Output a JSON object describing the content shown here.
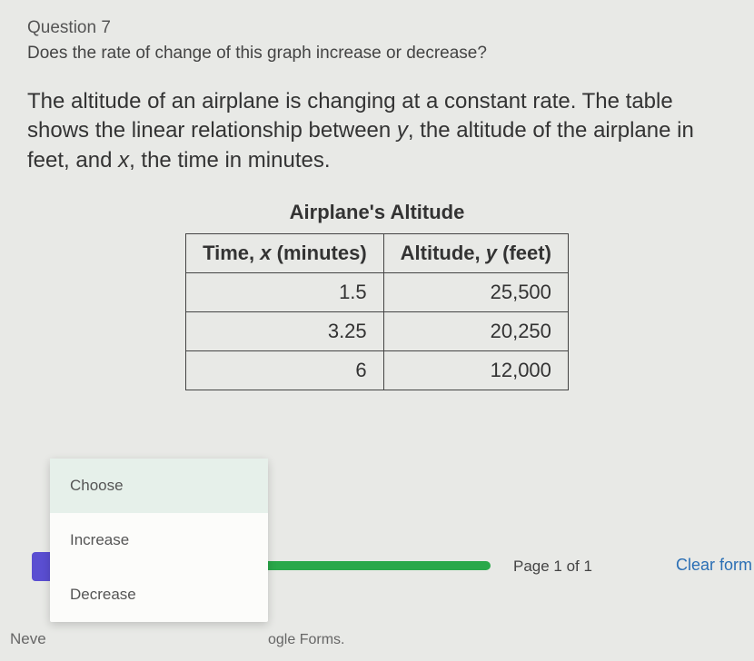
{
  "question": {
    "label": "Question 7",
    "prompt": "Does the rate of change of this graph increase or decrease?",
    "passage_before_y": "The altitude of an airplane is changing at a constant rate. The table shows the linear relationship between ",
    "y": "y",
    "passage_mid": ", the altitude of the airplane in feet, and ",
    "x": "x",
    "passage_after_x": ", the time in minutes."
  },
  "table": {
    "title": "Airplane's Altitude",
    "header_time_pre": "Time, ",
    "header_time_var": "x",
    "header_time_post": " (minutes)",
    "header_alt_pre": "Altitude, ",
    "header_alt_var": "y",
    "header_alt_post": " (feet)"
  },
  "chart_data": {
    "type": "table",
    "title": "Airplane's Altitude",
    "columns": [
      "Time, x (minutes)",
      "Altitude, y (feet)"
    ],
    "rows": [
      {
        "x": "1.5",
        "y": "25,500"
      },
      {
        "x": "3.25",
        "y": "20,250"
      },
      {
        "x": "6",
        "y": "12,000"
      }
    ]
  },
  "dropdown": {
    "options": [
      "Choose",
      "Increase",
      "Decrease"
    ],
    "selected_index": 0
  },
  "footer": {
    "never_fragment": "Neve",
    "forms_fragment": "ogle Forms.",
    "page_indicator": "Page 1 of 1",
    "clear_form": "Clear form"
  }
}
